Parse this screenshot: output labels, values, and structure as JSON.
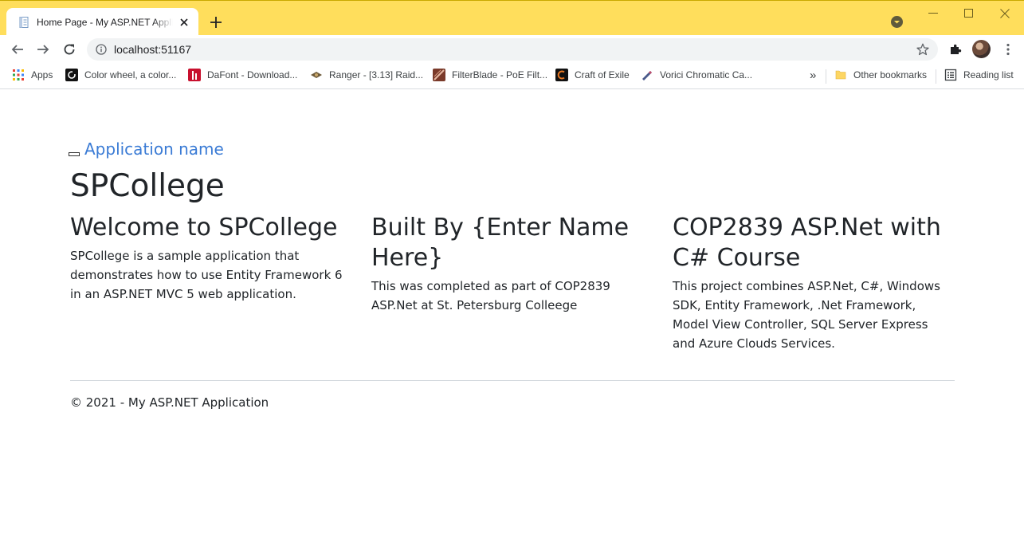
{
  "browser": {
    "tab_title": "Home Page - My ASP.NET Application",
    "url": "localhost:51167",
    "colors": {
      "titlebar": "#ffde5c",
      "omnibox": "#f1f3f4"
    },
    "bookmarks": [
      {
        "label": "Apps",
        "icon": "apps-grid-icon"
      },
      {
        "label": "Color wheel, a color...",
        "icon": "color-wheel-icon"
      },
      {
        "label": "DaFont - Download...",
        "icon": "dafont-icon"
      },
      {
        "label": "Ranger - [3.13] Raid...",
        "icon": "ranger-icon"
      },
      {
        "label": "FilterBlade - PoE Filt...",
        "icon": "filterblade-icon"
      },
      {
        "label": "Craft of Exile",
        "icon": "craft-of-exile-icon"
      },
      {
        "label": "Vorici Chromatic Ca...",
        "icon": "vorici-icon"
      }
    ],
    "overflow_label": "»",
    "other_bookmarks": "Other bookmarks",
    "reading_list": "Reading list"
  },
  "page": {
    "brand": "Application name",
    "title": "SPCollege",
    "columns": [
      {
        "heading": "Welcome to SPCollege",
        "text": "SPCollege is a sample application that demonstrates how to use Entity Framework 6 in an ASP.NET MVC 5 web application."
      },
      {
        "heading": "Built By {Enter Name Here}",
        "text": "This was completed as part of COP2839 ASP.Net at St. Petersburg Colleege"
      },
      {
        "heading": "COP2839 ASP.Net with C# Course",
        "text": "This project combines ASP.Net, C#, Windows SDK, Entity Framework, .Net Framework, Model View Controller, SQL Server Express and Azure Clouds Services."
      }
    ],
    "footer": "© 2021 - My ASP.NET Application",
    "colors": {
      "brand_link": "#3a7bd5",
      "text": "#212529"
    }
  }
}
